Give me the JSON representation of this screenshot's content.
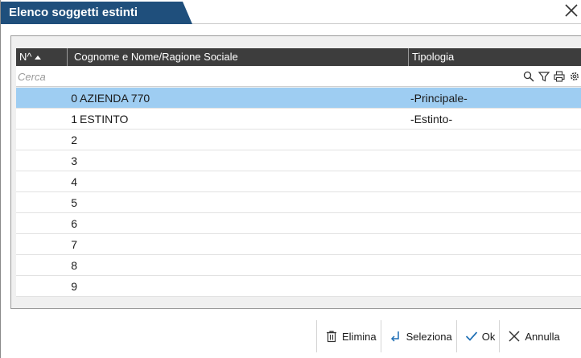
{
  "window": {
    "title": "Elenco soggetti estinti"
  },
  "grid": {
    "columns": [
      {
        "label": "N^",
        "sort": "ascending"
      },
      {
        "label": "Cognome e Nome/Ragione Sociale"
      },
      {
        "label": "Tipologia"
      }
    ],
    "filter": {
      "placeholder": "Cerca",
      "value": ""
    },
    "tools": [
      "search-icon",
      "filter-icon",
      "print-icon",
      "settings-icon"
    ],
    "rows": [
      {
        "num": "0",
        "name": "AZIENDA 770",
        "tipo": "-Principale-",
        "selected": true
      },
      {
        "num": "1",
        "name": "ESTINTO",
        "tipo": "-Estinto-"
      },
      {
        "num": "2",
        "name": "",
        "tipo": ""
      },
      {
        "num": "3",
        "name": "",
        "tipo": ""
      },
      {
        "num": "4",
        "name": "",
        "tipo": ""
      },
      {
        "num": "5",
        "name": "",
        "tipo": ""
      },
      {
        "num": "6",
        "name": "",
        "tipo": ""
      },
      {
        "num": "7",
        "name": "",
        "tipo": ""
      },
      {
        "num": "8",
        "name": "",
        "tipo": ""
      },
      {
        "num": "9",
        "name": "",
        "tipo": ""
      }
    ]
  },
  "footer": {
    "elimina": "Elimina",
    "seleziona": "Seleziona",
    "ok": "Ok",
    "annulla": "Annulla"
  },
  "colors": {
    "title_bg": "#1f4f7c",
    "header_bg": "#3d3d3d",
    "selected_row": "#9ecdf2"
  }
}
